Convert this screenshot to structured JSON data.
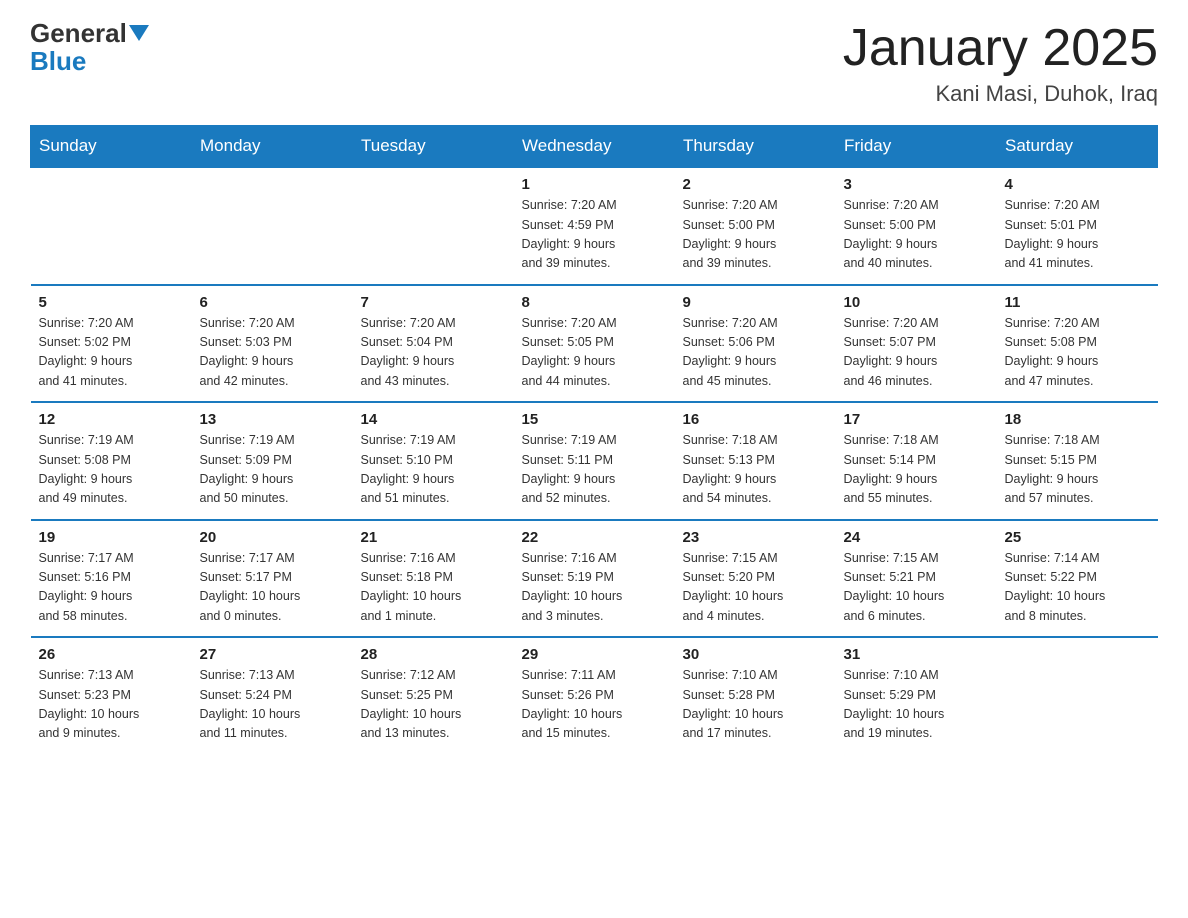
{
  "header": {
    "logo_general": "General",
    "logo_blue": "Blue",
    "title": "January 2025",
    "subtitle": "Kani Masi, Duhok, Iraq"
  },
  "days_of_week": [
    "Sunday",
    "Monday",
    "Tuesday",
    "Wednesday",
    "Thursday",
    "Friday",
    "Saturday"
  ],
  "weeks": [
    [
      {
        "day": "",
        "info": ""
      },
      {
        "day": "",
        "info": ""
      },
      {
        "day": "",
        "info": ""
      },
      {
        "day": "1",
        "info": "Sunrise: 7:20 AM\nSunset: 4:59 PM\nDaylight: 9 hours\nand 39 minutes."
      },
      {
        "day": "2",
        "info": "Sunrise: 7:20 AM\nSunset: 5:00 PM\nDaylight: 9 hours\nand 39 minutes."
      },
      {
        "day": "3",
        "info": "Sunrise: 7:20 AM\nSunset: 5:00 PM\nDaylight: 9 hours\nand 40 minutes."
      },
      {
        "day": "4",
        "info": "Sunrise: 7:20 AM\nSunset: 5:01 PM\nDaylight: 9 hours\nand 41 minutes."
      }
    ],
    [
      {
        "day": "5",
        "info": "Sunrise: 7:20 AM\nSunset: 5:02 PM\nDaylight: 9 hours\nand 41 minutes."
      },
      {
        "day": "6",
        "info": "Sunrise: 7:20 AM\nSunset: 5:03 PM\nDaylight: 9 hours\nand 42 minutes."
      },
      {
        "day": "7",
        "info": "Sunrise: 7:20 AM\nSunset: 5:04 PM\nDaylight: 9 hours\nand 43 minutes."
      },
      {
        "day": "8",
        "info": "Sunrise: 7:20 AM\nSunset: 5:05 PM\nDaylight: 9 hours\nand 44 minutes."
      },
      {
        "day": "9",
        "info": "Sunrise: 7:20 AM\nSunset: 5:06 PM\nDaylight: 9 hours\nand 45 minutes."
      },
      {
        "day": "10",
        "info": "Sunrise: 7:20 AM\nSunset: 5:07 PM\nDaylight: 9 hours\nand 46 minutes."
      },
      {
        "day": "11",
        "info": "Sunrise: 7:20 AM\nSunset: 5:08 PM\nDaylight: 9 hours\nand 47 minutes."
      }
    ],
    [
      {
        "day": "12",
        "info": "Sunrise: 7:19 AM\nSunset: 5:08 PM\nDaylight: 9 hours\nand 49 minutes."
      },
      {
        "day": "13",
        "info": "Sunrise: 7:19 AM\nSunset: 5:09 PM\nDaylight: 9 hours\nand 50 minutes."
      },
      {
        "day": "14",
        "info": "Sunrise: 7:19 AM\nSunset: 5:10 PM\nDaylight: 9 hours\nand 51 minutes."
      },
      {
        "day": "15",
        "info": "Sunrise: 7:19 AM\nSunset: 5:11 PM\nDaylight: 9 hours\nand 52 minutes."
      },
      {
        "day": "16",
        "info": "Sunrise: 7:18 AM\nSunset: 5:13 PM\nDaylight: 9 hours\nand 54 minutes."
      },
      {
        "day": "17",
        "info": "Sunrise: 7:18 AM\nSunset: 5:14 PM\nDaylight: 9 hours\nand 55 minutes."
      },
      {
        "day": "18",
        "info": "Sunrise: 7:18 AM\nSunset: 5:15 PM\nDaylight: 9 hours\nand 57 minutes."
      }
    ],
    [
      {
        "day": "19",
        "info": "Sunrise: 7:17 AM\nSunset: 5:16 PM\nDaylight: 9 hours\nand 58 minutes."
      },
      {
        "day": "20",
        "info": "Sunrise: 7:17 AM\nSunset: 5:17 PM\nDaylight: 10 hours\nand 0 minutes."
      },
      {
        "day": "21",
        "info": "Sunrise: 7:16 AM\nSunset: 5:18 PM\nDaylight: 10 hours\nand 1 minute."
      },
      {
        "day": "22",
        "info": "Sunrise: 7:16 AM\nSunset: 5:19 PM\nDaylight: 10 hours\nand 3 minutes."
      },
      {
        "day": "23",
        "info": "Sunrise: 7:15 AM\nSunset: 5:20 PM\nDaylight: 10 hours\nand 4 minutes."
      },
      {
        "day": "24",
        "info": "Sunrise: 7:15 AM\nSunset: 5:21 PM\nDaylight: 10 hours\nand 6 minutes."
      },
      {
        "day": "25",
        "info": "Sunrise: 7:14 AM\nSunset: 5:22 PM\nDaylight: 10 hours\nand 8 minutes."
      }
    ],
    [
      {
        "day": "26",
        "info": "Sunrise: 7:13 AM\nSunset: 5:23 PM\nDaylight: 10 hours\nand 9 minutes."
      },
      {
        "day": "27",
        "info": "Sunrise: 7:13 AM\nSunset: 5:24 PM\nDaylight: 10 hours\nand 11 minutes."
      },
      {
        "day": "28",
        "info": "Sunrise: 7:12 AM\nSunset: 5:25 PM\nDaylight: 10 hours\nand 13 minutes."
      },
      {
        "day": "29",
        "info": "Sunrise: 7:11 AM\nSunset: 5:26 PM\nDaylight: 10 hours\nand 15 minutes."
      },
      {
        "day": "30",
        "info": "Sunrise: 7:10 AM\nSunset: 5:28 PM\nDaylight: 10 hours\nand 17 minutes."
      },
      {
        "day": "31",
        "info": "Sunrise: 7:10 AM\nSunset: 5:29 PM\nDaylight: 10 hours\nand 19 minutes."
      },
      {
        "day": "",
        "info": ""
      }
    ]
  ]
}
